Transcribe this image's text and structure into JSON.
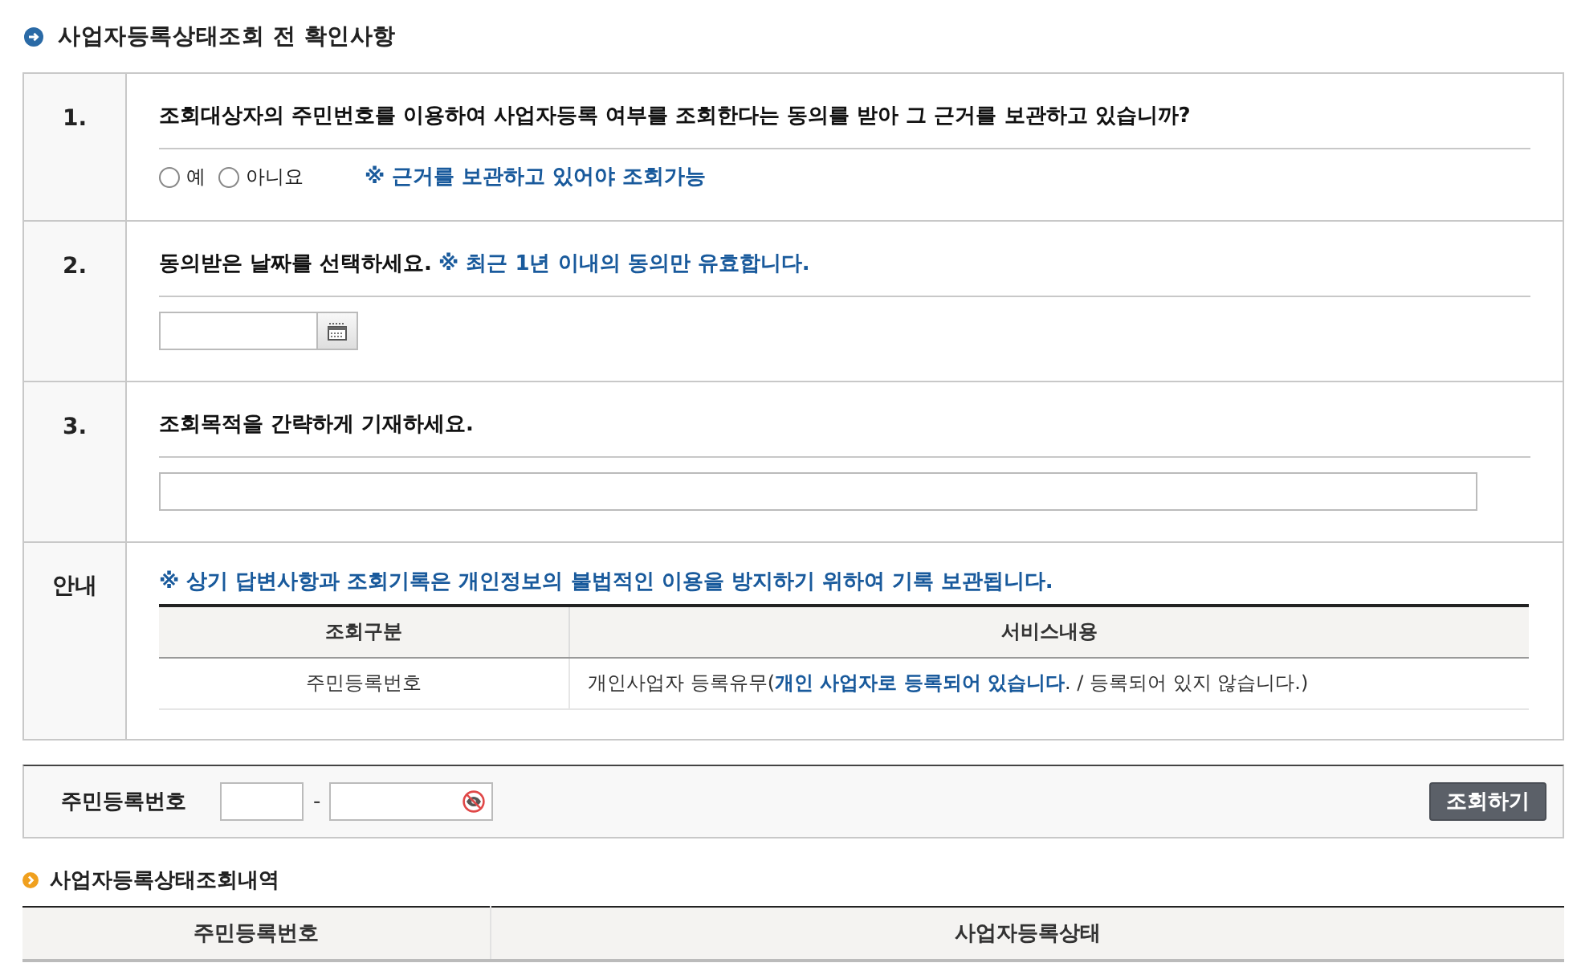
{
  "title": "사업자등록상태조회 전 확인사항",
  "questions": [
    {
      "number": "1.",
      "kind": "radio",
      "text": "조회대상자의 주민번호를 이용하여 사업자등록 여부를 조회한다는 동의를 받아 그 근거를 보관하고 있습니까?",
      "options": [
        {
          "label": "예",
          "selected": false
        },
        {
          "label": "아니요",
          "selected": false
        }
      ],
      "note": "※ 근거를 보관하고 있어야 조회가능"
    },
    {
      "number": "2.",
      "kind": "date",
      "text": "동의받은 날짜를 선택하세요.",
      "hint": "※ 최근 1년 이내의 동의만 유효합니다."
    },
    {
      "number": "3.",
      "kind": "text",
      "text": "조회목적을 간략하게 기재하세요."
    }
  ],
  "notice": {
    "label": "안내",
    "text": "※ 상기 답변사항과 조회기록은 개인정보의 불법적인 이용을 방지하기 위하여 기록 보관됩니다.",
    "columns": [
      "조회구분",
      "서비스내용"
    ],
    "rows": [
      [
        "주민등록번호",
        "개인사업자 등록유무(**개인 사업자로 등록되어 있습니다**. / 등록되어 있지 않습니다.)"
      ]
    ]
  },
  "search": {
    "label": "주민등록번호",
    "separator": "-",
    "button": "조회하기"
  },
  "results": {
    "title": "사업자등록상태조회내역",
    "columns": [
      "주민등록번호",
      "사업자등록상태"
    ]
  }
}
